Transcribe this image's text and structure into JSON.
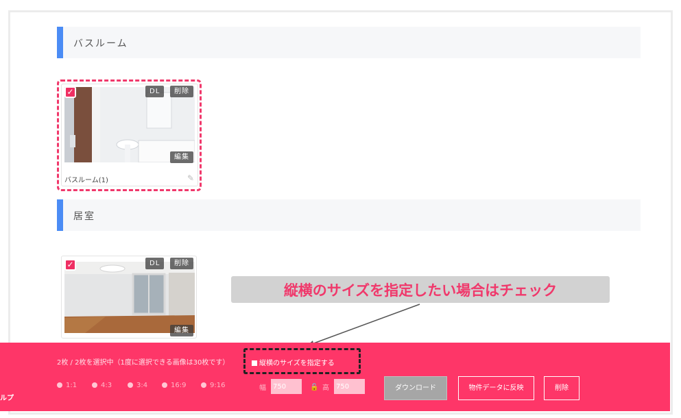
{
  "sections": [
    {
      "title": "バスルーム",
      "photo": {
        "caption": "バスルーム(1)",
        "dl_label": "DL",
        "delete_label": "削除",
        "edit_label": "編集",
        "checked": true
      }
    },
    {
      "title": "居室",
      "photo": {
        "dl_label": "DL",
        "delete_label": "削除",
        "edit_label": "編集",
        "checked": true
      }
    }
  ],
  "tooltip": {
    "text": "縦横のサイズを指定したい場合はチェック"
  },
  "bottom_bar": {
    "left_edge_label": "ルプ",
    "selection_info": "2枚 / 2枚を選択中（1度に選択できる画像は30枚です）",
    "size_checkbox_label": "縦横のサイズを指定する",
    "ratios": [
      "1:1",
      "4:3",
      "3:4",
      "16:9",
      "9:16"
    ],
    "width_label": "幅",
    "width_value": "750",
    "height_label": "高",
    "height_value": "750",
    "download_label": "ダウンロード",
    "reflect_label": "物件データに反映",
    "delete_label": "削除"
  },
  "colors": {
    "accent": "#fe3668",
    "section_bar": "#4b8cf5",
    "tooltip_text": "#f0386b"
  }
}
